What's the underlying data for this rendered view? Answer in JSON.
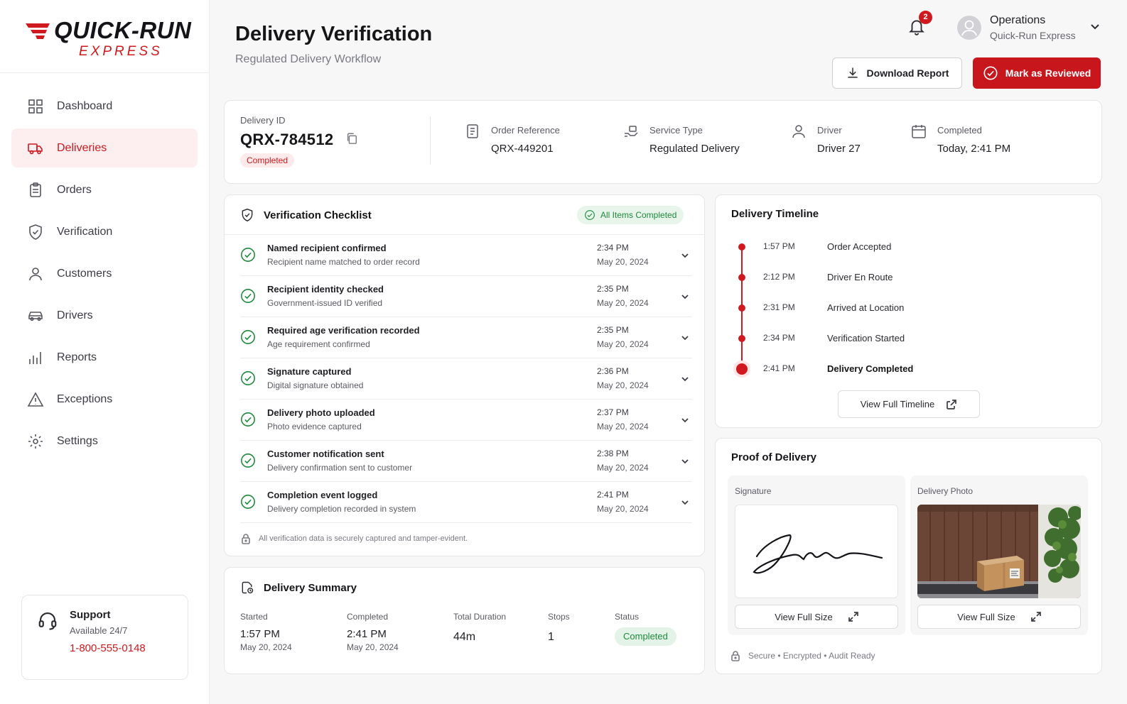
{
  "brand": {
    "name": "QUICK-RUN",
    "tagline": "EXPRESS",
    "accent": "#d0191f"
  },
  "sidebar": {
    "items": [
      {
        "label": "Dashboard",
        "icon": "grid-icon",
        "active": false
      },
      {
        "label": "Deliveries",
        "icon": "truck-icon",
        "active": true
      },
      {
        "label": "Orders",
        "icon": "clipboard-icon",
        "active": false
      },
      {
        "label": "Verification",
        "icon": "shield-check-icon",
        "active": false
      },
      {
        "label": "Customers",
        "icon": "user-icon",
        "active": false
      },
      {
        "label": "Drivers",
        "icon": "car-icon",
        "active": false
      },
      {
        "label": "Reports",
        "icon": "bar-chart-icon",
        "active": false
      },
      {
        "label": "Exceptions",
        "icon": "warning-icon",
        "active": false
      },
      {
        "label": "Settings",
        "icon": "gear-icon",
        "active": false
      }
    ],
    "support": {
      "title": "Support",
      "availability": "Available 24/7",
      "phone": "1-800-555-0148"
    }
  },
  "header": {
    "title": "Delivery Verification",
    "subtitle": "Regulated Delivery Workflow",
    "notifications": "2",
    "user": {
      "name": "Operations",
      "org": "Quick-Run Express"
    },
    "download_label": "Download Report",
    "review_label": "Mark as Reviewed"
  },
  "delivery": {
    "id_label": "Delivery ID",
    "id": "QRX-784512",
    "status": "Completed",
    "meta": [
      {
        "label": "Order Reference",
        "value": "QRX-449201",
        "icon": "document-icon"
      },
      {
        "label": "Service Type",
        "value": "Regulated Delivery",
        "icon": "delivery-box-icon"
      },
      {
        "label": "Driver",
        "value": "Driver 27",
        "icon": "person-icon"
      },
      {
        "label": "Completed",
        "value": "Today, 2:41 PM",
        "icon": "calendar-icon"
      }
    ]
  },
  "checklist": {
    "title": "Verification Checklist",
    "badge": "All Items Completed",
    "items": [
      {
        "title": "Named recipient confirmed",
        "sub": "Recipient name matched to order record",
        "time": "2:34 PM",
        "date": "May 20, 2024"
      },
      {
        "title": "Recipient identity checked",
        "sub": "Government-issued ID verified",
        "time": "2:35 PM",
        "date": "May 20, 2024"
      },
      {
        "title": "Required age verification recorded",
        "sub": "Age requirement confirmed",
        "time": "2:35 PM",
        "date": "May 20, 2024"
      },
      {
        "title": "Signature captured",
        "sub": "Digital signature obtained",
        "time": "2:36 PM",
        "date": "May 20, 2024"
      },
      {
        "title": "Delivery photo uploaded",
        "sub": "Photo evidence captured",
        "time": "2:37 PM",
        "date": "May 20, 2024"
      },
      {
        "title": "Customer notification sent",
        "sub": "Delivery confirmation sent to customer",
        "time": "2:38 PM",
        "date": "May 20, 2024"
      },
      {
        "title": "Completion event logged",
        "sub": "Delivery completion recorded in system",
        "time": "2:41 PM",
        "date": "May 20, 2024"
      }
    ],
    "note": "All verification data is securely captured and tamper-evident."
  },
  "summary": {
    "title": "Delivery Summary",
    "started_label": "Started",
    "started_time": "1:57 PM",
    "started_date": "May 20, 2024",
    "completed_label": "Completed",
    "completed_time": "2:41 PM",
    "completed_date": "May 20, 2024",
    "duration_label": "Total Duration",
    "duration": "44m",
    "stops_label": "Stops",
    "stops": "1",
    "status_label": "Status",
    "status": "Completed"
  },
  "timeline": {
    "title": "Delivery Timeline",
    "events": [
      {
        "time": "1:57 PM",
        "label": "Order Accepted"
      },
      {
        "time": "2:12 PM",
        "label": "Driver En Route"
      },
      {
        "time": "2:31 PM",
        "label": "Arrived at Location"
      },
      {
        "time": "2:34 PM",
        "label": "Verification Started"
      },
      {
        "time": "2:41 PM",
        "label": "Delivery Completed"
      }
    ],
    "button": "View Full Timeline"
  },
  "proof": {
    "title": "Proof of Delivery",
    "signature_label": "Signature",
    "photo_label": "Delivery Photo",
    "view_label": "View Full Size",
    "footer": "Secure • Encrypted • Audit Ready"
  }
}
